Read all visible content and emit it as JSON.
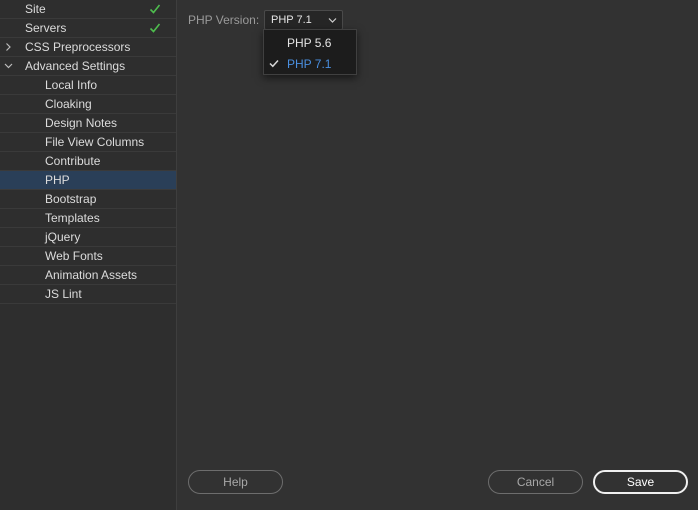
{
  "sidebar": {
    "items": [
      {
        "label": "Site",
        "checked": true
      },
      {
        "label": "Servers",
        "checked": true
      },
      {
        "label": "CSS Preprocessors",
        "expand": "collapsed"
      },
      {
        "label": "Advanced Settings",
        "expand": "expanded"
      }
    ],
    "children": [
      {
        "label": "Local Info"
      },
      {
        "label": "Cloaking"
      },
      {
        "label": "Design Notes"
      },
      {
        "label": "File View Columns"
      },
      {
        "label": "Contribute"
      },
      {
        "label": "PHP",
        "selected": true
      },
      {
        "label": "Bootstrap"
      },
      {
        "label": "Templates"
      },
      {
        "label": "jQuery"
      },
      {
        "label": "Web Fonts"
      },
      {
        "label": "Animation Assets"
      },
      {
        "label": "JS Lint"
      }
    ],
    "check_color": "#4ebd4e",
    "selected_color": "#2a3f58"
  },
  "php": {
    "label": "PHP Version:",
    "selected_value": "PHP 7.1",
    "options": [
      {
        "label": "PHP 5.6",
        "selected": false
      },
      {
        "label": "PHP 7.1",
        "selected": true
      }
    ],
    "selected_option_color": "#4a8fe0"
  },
  "buttons": {
    "help": "Help",
    "cancel": "Cancel",
    "save": "Save"
  }
}
